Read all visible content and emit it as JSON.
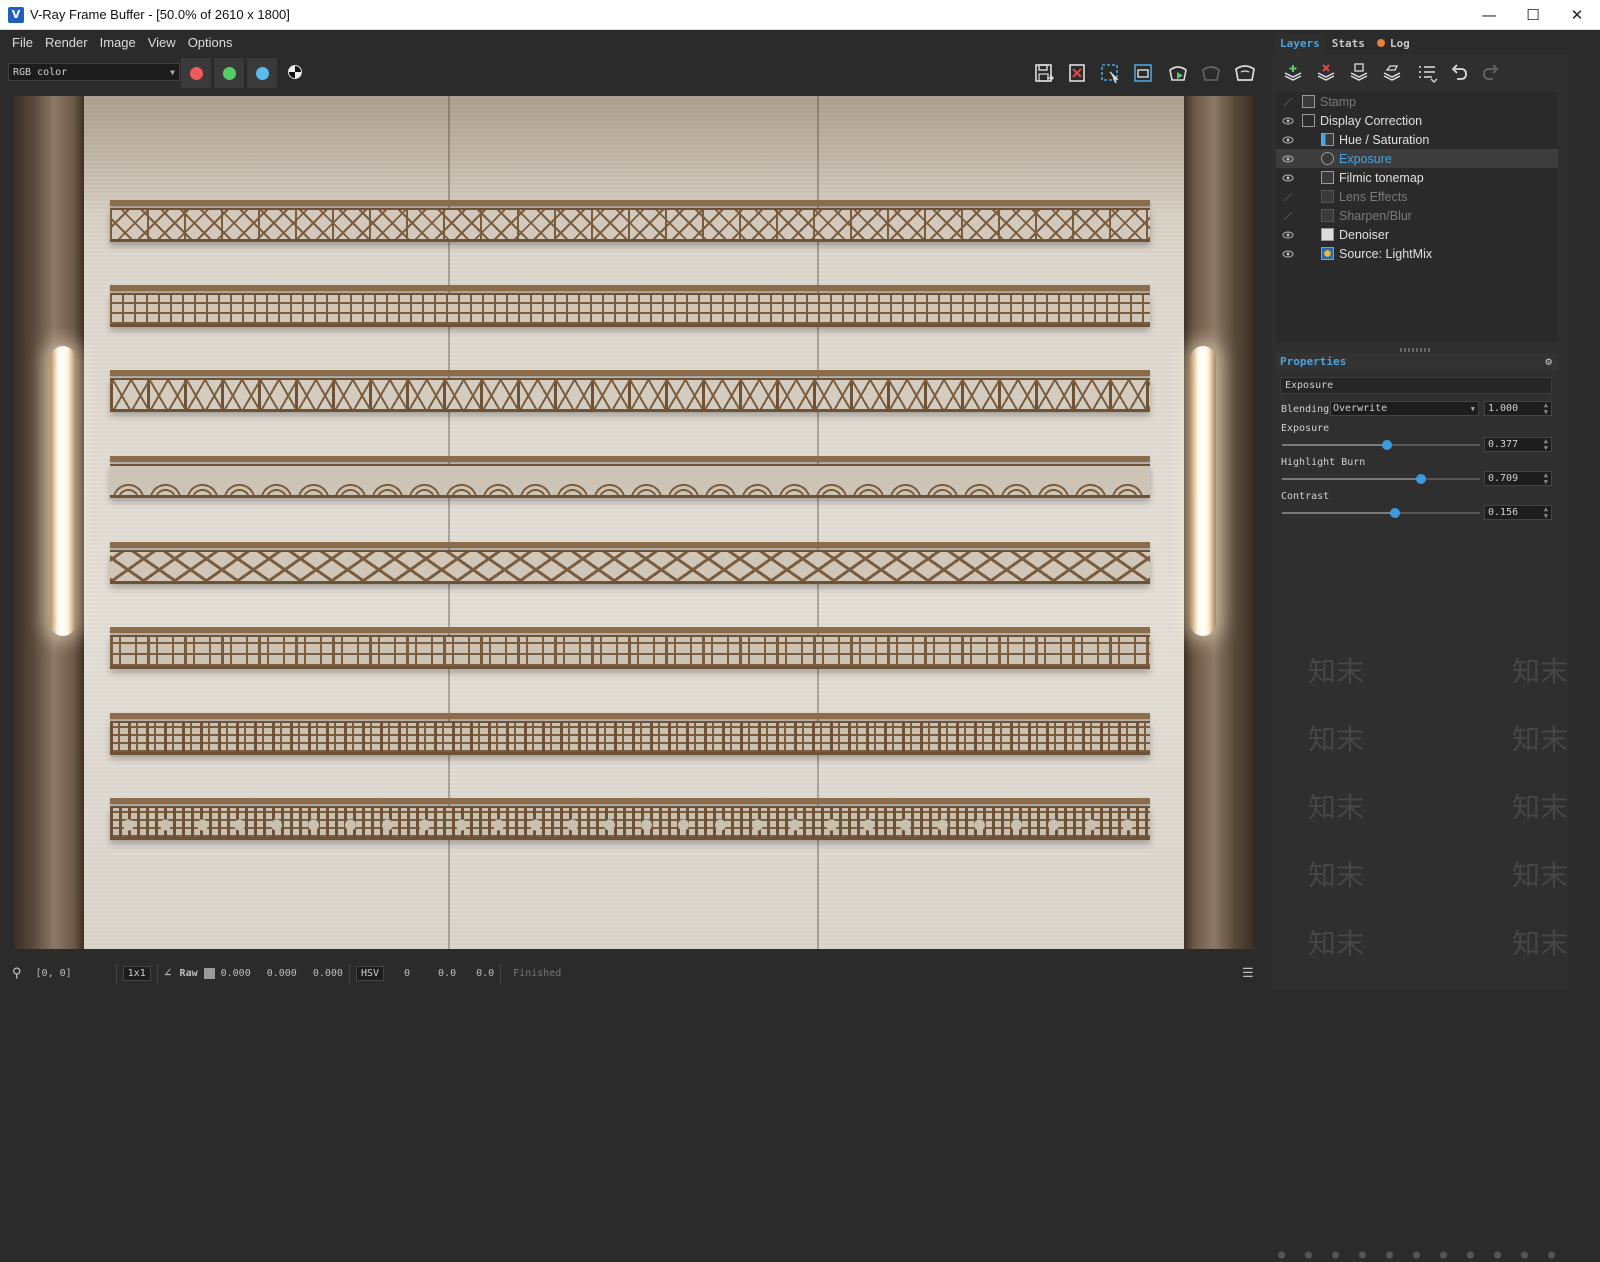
{
  "window": {
    "title": "V-Ray Frame Buffer - [50.0% of 2610 x 1800]",
    "app_icon_letter": "V",
    "minimize_glyph": "—",
    "maximize_glyph": "☐",
    "close_glyph": "✕"
  },
  "menu": [
    "File",
    "Render",
    "Image",
    "View",
    "Options"
  ],
  "toolbar": {
    "channel_select": "RGB color",
    "channel_colors": {
      "red": "#f05b5b",
      "green": "#55cc66",
      "blue": "#5bbbea"
    },
    "icons": [
      "save-image-icon",
      "clear-image-icon",
      "region-render-icon",
      "fit-window-icon",
      "render-interactive-icon",
      "stop-render-icon",
      "render-icon"
    ]
  },
  "viewport": {
    "description_icons": [
      "render-image"
    ],
    "accent": "#8b6d4c"
  },
  "status": {
    "coords": "[0, 0]",
    "zoom": "1x1",
    "raw_label": "Raw",
    "r": "0.000",
    "g": "0.000",
    "b": "0.000",
    "color_space": "HSV",
    "h": "0",
    "s": "0.0",
    "v": "0.0",
    "state": "Finished"
  },
  "panel": {
    "tabs": [
      "Layers",
      "Stats",
      "Log"
    ],
    "active_tab": "Layers",
    "log_dot_color": "#e8803a",
    "layer_tool_icons": [
      "add-layer-icon",
      "delete-layer-icon",
      "save-layers-icon",
      "load-layers-icon",
      "layer-menu-icon",
      "undo-icon",
      "redo-icon"
    ],
    "layers": [
      {
        "label": "Stamp",
        "enabled": false,
        "indent": 0
      },
      {
        "label": "Display Correction",
        "enabled": true,
        "indent": 0
      },
      {
        "label": "Hue / Saturation",
        "enabled": true,
        "indent": 1
      },
      {
        "label": "Exposure",
        "enabled": true,
        "indent": 1,
        "selected": true
      },
      {
        "label": "Filmic tonemap",
        "enabled": true,
        "indent": 1
      },
      {
        "label": "Lens Effects",
        "enabled": false,
        "indent": 1
      },
      {
        "label": "Sharpen/Blur",
        "enabled": false,
        "indent": 1
      },
      {
        "label": "Denoiser",
        "enabled": true,
        "indent": 1
      },
      {
        "label": "Source: LightMix",
        "enabled": true,
        "indent": 1
      }
    ],
    "properties": {
      "header": "Properties",
      "layer_name": "Exposure",
      "blending_label": "Blending",
      "blending_mode": "Overwrite",
      "opacity": "1.000",
      "sliders": [
        {
          "label": "Exposure",
          "value": "0.377",
          "fraction": 0.53
        },
        {
          "label": "Highlight Burn",
          "value": "0.709",
          "fraction": 0.7
        },
        {
          "label": "Contrast",
          "value": "0.156",
          "fraction": 0.57
        }
      ]
    }
  },
  "watermark": {
    "text": "知末",
    "color": "#5a5a5a"
  }
}
